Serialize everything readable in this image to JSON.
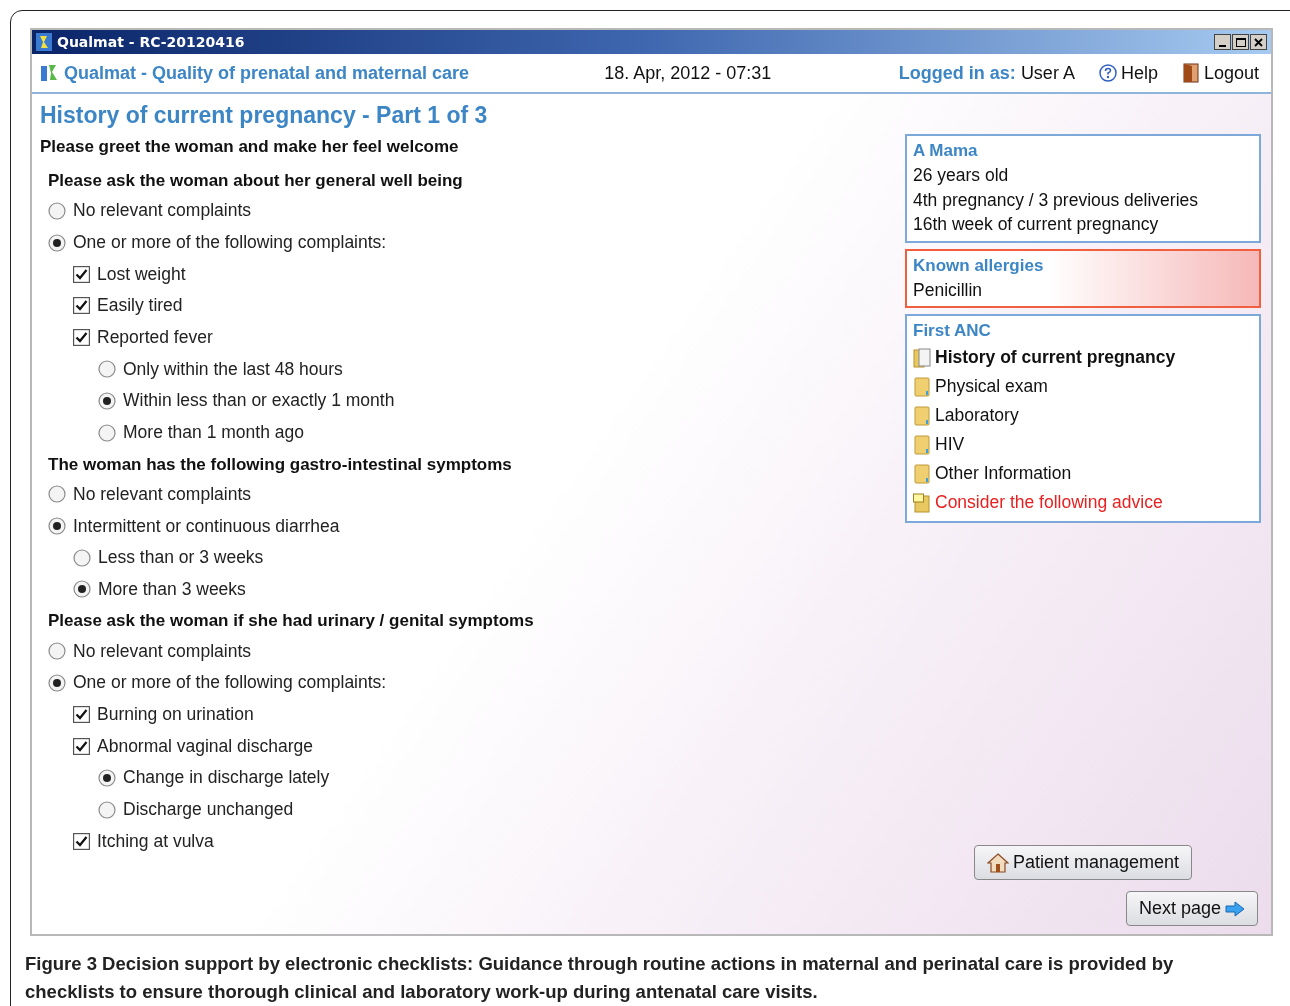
{
  "window": {
    "title": "Qualmat - RC-20120416"
  },
  "header": {
    "app_name": "Qualmat - Quality of prenatal and maternal care",
    "datetime": "18. Apr, 2012 - 07:31",
    "login_label": "Logged in as:",
    "user": "User A",
    "help": "Help",
    "logout": "Logout"
  },
  "page_title": "History of current pregnancy - Part 1 of 3",
  "intro": "Please greet the woman and make her feel welcome",
  "sections": [
    {
      "heading": "Please ask the woman about her general well being",
      "options": [
        {
          "kind": "radio",
          "label": "No relevant complaints",
          "selected": false
        },
        {
          "kind": "radio",
          "label": "One or more of the following complaints:",
          "selected": true,
          "children": [
            {
              "kind": "checkbox",
              "label": "Lost weight",
              "checked": true
            },
            {
              "kind": "checkbox",
              "label": "Easily tired",
              "checked": true
            },
            {
              "kind": "checkbox",
              "label": "Reported fever",
              "checked": true,
              "children": [
                {
                  "kind": "radio",
                  "label": "Only within the last 48 hours",
                  "selected": false
                },
                {
                  "kind": "radio",
                  "label": "Within less than or exactly 1 month",
                  "selected": true
                },
                {
                  "kind": "radio",
                  "label": "More than 1 month ago",
                  "selected": false
                }
              ]
            }
          ]
        }
      ]
    },
    {
      "heading": "The woman has the following gastro-intestinal symptoms",
      "options": [
        {
          "kind": "radio",
          "label": "No relevant complaints",
          "selected": false
        },
        {
          "kind": "radio",
          "label": "Intermittent or continuous diarrhea",
          "selected": true,
          "children": [
            {
              "kind": "radio",
              "label": "Less than or 3 weeks",
              "selected": false
            },
            {
              "kind": "radio",
              "label": "More than 3 weeks",
              "selected": true
            }
          ]
        }
      ]
    },
    {
      "heading": "Please ask the woman if she had urinary / genital symptoms",
      "options": [
        {
          "kind": "radio",
          "label": "No relevant complaints",
          "selected": false
        },
        {
          "kind": "radio",
          "label": "One or more of the following complaints:",
          "selected": true,
          "children": [
            {
              "kind": "checkbox",
              "label": "Burning on urination",
              "checked": true
            },
            {
              "kind": "checkbox",
              "label": "Abnormal vaginal discharge",
              "checked": true,
              "children": [
                {
                  "kind": "radio",
                  "label": "Change in discharge lately",
                  "selected": true
                },
                {
                  "kind": "radio",
                  "label": "Discharge unchanged",
                  "selected": false
                }
              ]
            },
            {
              "kind": "checkbox",
              "label": "Itching at vulva",
              "checked": true
            }
          ]
        }
      ]
    }
  ],
  "patient": {
    "name": "A Mama",
    "lines": [
      "26 years old",
      "4th pregnancy / 3 previous deliveries",
      "16th week of current pregnancy"
    ]
  },
  "allergies": {
    "title": "Known allergies",
    "items": [
      "Penicillin"
    ]
  },
  "visit": {
    "title": "First ANC",
    "items": [
      {
        "kind": "page",
        "label": "History of current pregnancy",
        "selected": true
      },
      {
        "kind": "page",
        "label": "Physical exam",
        "selected": false
      },
      {
        "kind": "page",
        "label": "Laboratory",
        "selected": false
      },
      {
        "kind": "page",
        "label": "HIV",
        "selected": false
      },
      {
        "kind": "page",
        "label": "Other Information",
        "selected": false
      },
      {
        "kind": "advice",
        "label": "Consider the following advice",
        "selected": false
      }
    ]
  },
  "buttons": [
    {
      "kind": "house",
      "label": "Patient management"
    },
    {
      "kind": "arrow",
      "label": "Next page"
    }
  ],
  "caption": "Figure 3 Decision support by electronic checklists: Guidance through routine actions in maternal and perinatal care is provided by checklists to ensure thorough clinical and laboratory work-up during antenatal care visits."
}
